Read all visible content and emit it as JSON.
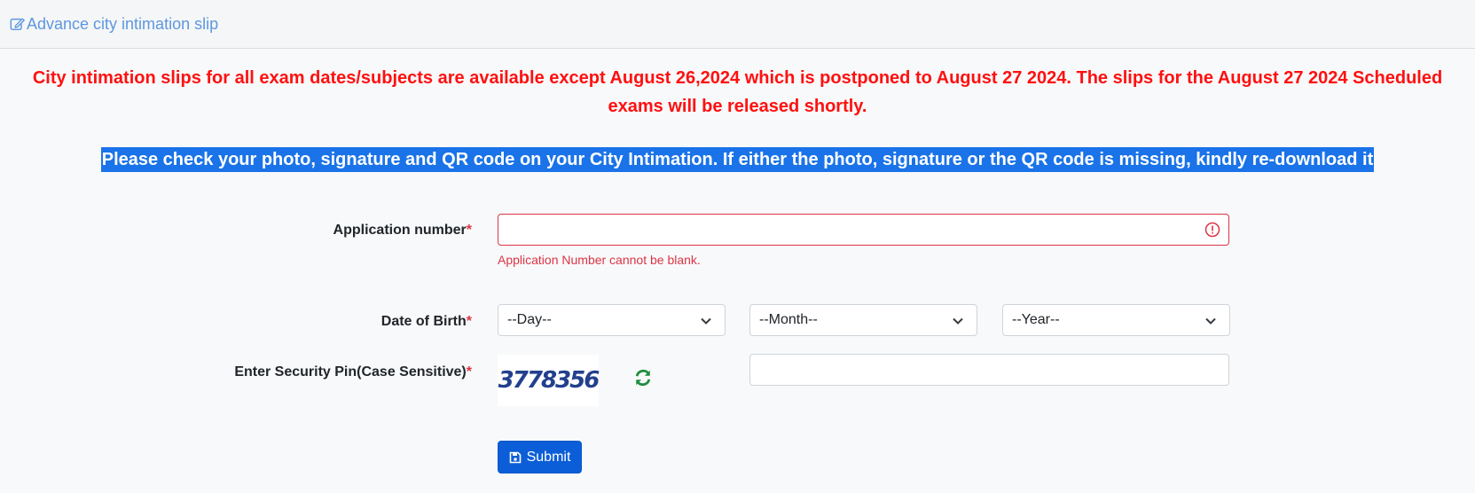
{
  "header": {
    "title": "Advance city intimation slip",
    "icon": "edit-icon"
  },
  "notices": {
    "red": "City intimation slips for all exam dates/subjects are available except August 26,2024 which is postponed to August 27 2024. The slips for the August 27 2024 Scheduled exams will be released shortly.",
    "highlighted": "Please check your photo, signature and QR code on your City Intimation. If either the photo, signature or the QR code is missing, kindly re-download it"
  },
  "form": {
    "application_number": {
      "label": "Application number",
      "required_mark": "*",
      "value": "",
      "error": "Application Number cannot be blank."
    },
    "dob": {
      "label": "Date of Birth",
      "required_mark": "*",
      "day": "--Day--",
      "month": "--Month--",
      "year": "--Year--"
    },
    "security_pin": {
      "label": "Enter Security Pin(Case Sensitive)",
      "required_mark": "*",
      "captcha_text": "3778356",
      "value": ""
    },
    "submit_label": "Submit"
  },
  "colors": {
    "accent": "#0b5ed7",
    "error": "#dc3545",
    "notice_red": "#ff1010",
    "highlight": "#1a73e8",
    "header_link": "#5d97e0",
    "refresh": "#1e8e3e"
  }
}
